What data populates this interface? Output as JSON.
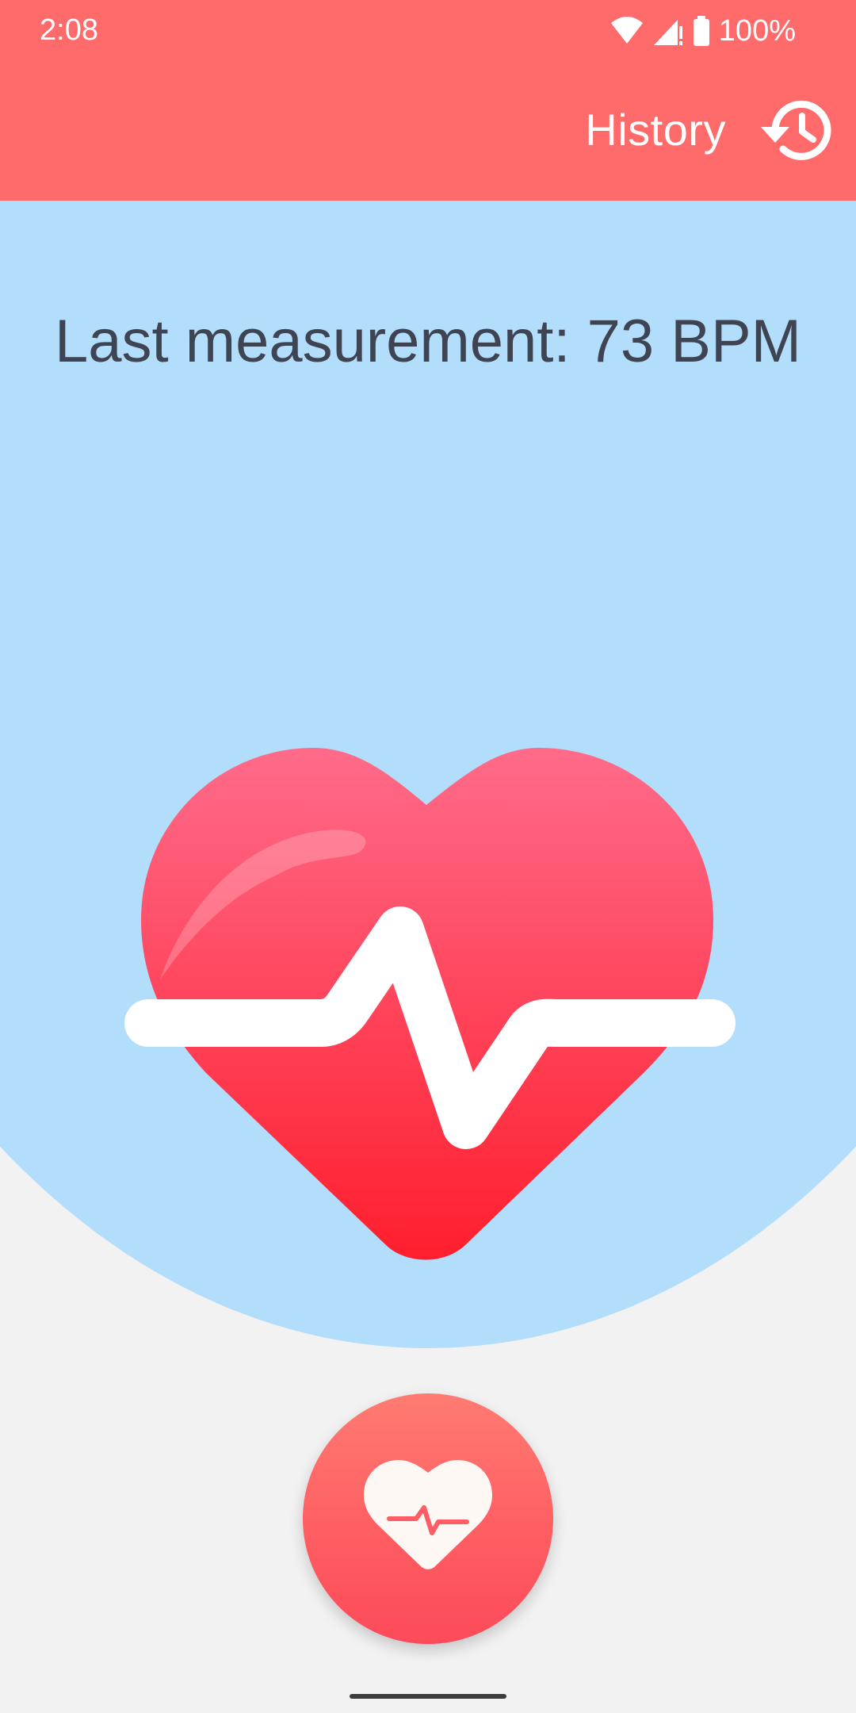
{
  "status_bar": {
    "time": "2:08",
    "battery_text": "100%",
    "icons": [
      "wifi-icon",
      "cell-signal-icon",
      "battery-icon"
    ]
  },
  "toolbar": {
    "history_label": "History",
    "history_icon": "history-icon"
  },
  "main": {
    "last_measurement": "Last measurement: 73 BPM",
    "hero_icon": "heart-pulse-icon"
  },
  "measure_button": {
    "icon": "heart-pulse-icon"
  },
  "colors": {
    "app_bar": "#ff6b6b",
    "content_background": "#b2ddfb",
    "page_background": "#f2f2f2",
    "text": "#3f4453",
    "heart_top": "#ff6b8a",
    "heart_bottom": "#ff1e2d"
  }
}
